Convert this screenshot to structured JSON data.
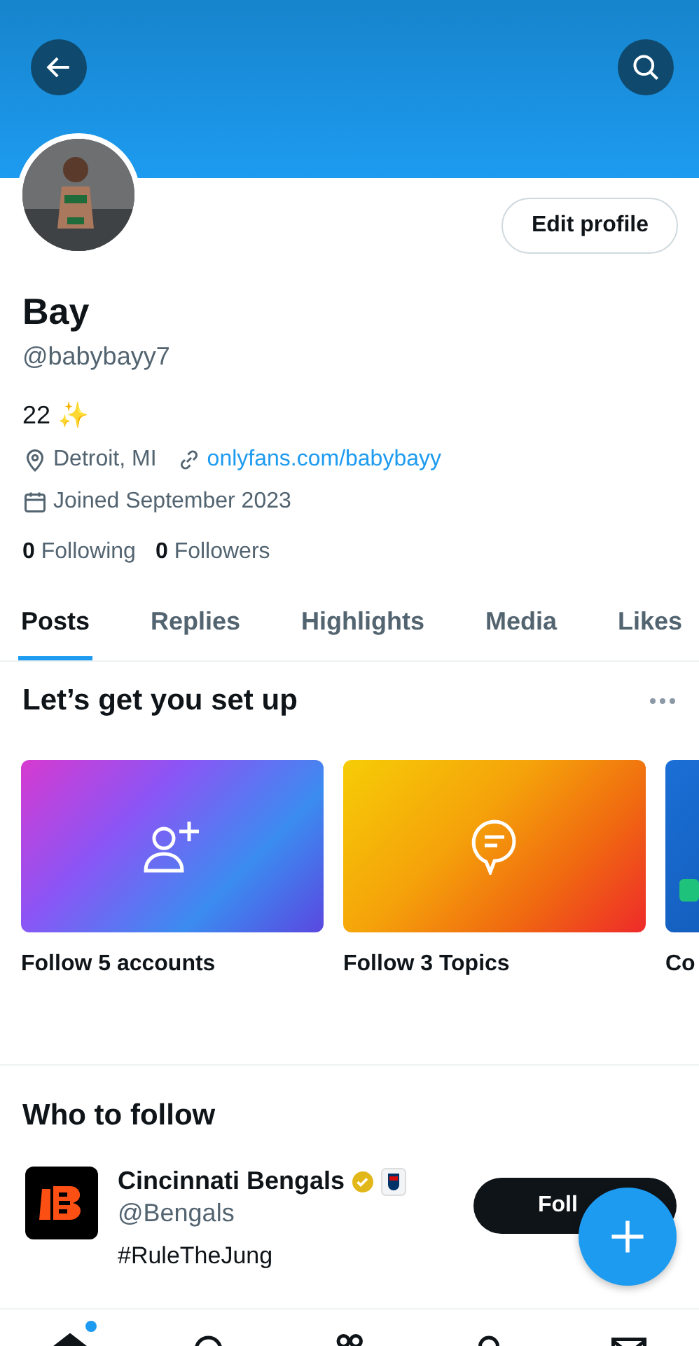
{
  "profile": {
    "edit_button": "Edit profile",
    "name": "Bay",
    "handle": "@babybayy7",
    "bio": "22 ✨",
    "location": "Detroit, MI",
    "link": "onlyfans.com/babybayy",
    "joined": "Joined September 2023",
    "following_count": "0",
    "following_label": "Following",
    "followers_count": "0",
    "followers_label": "Followers"
  },
  "tabs": [
    {
      "label": "Posts",
      "selected": true
    },
    {
      "label": "Replies",
      "selected": false
    },
    {
      "label": "Highlights",
      "selected": false
    },
    {
      "label": "Media",
      "selected": false
    },
    {
      "label": "Likes",
      "selected": false
    }
  ],
  "setup": {
    "title": "Let’s get you set up",
    "cards": [
      {
        "kind": "accounts",
        "label": "Follow 5 accounts"
      },
      {
        "kind": "topics",
        "label": "Follow 3 Topics"
      },
      {
        "kind": "other",
        "label": "Co"
      }
    ]
  },
  "who_to_follow": {
    "title": "Who to follow",
    "accounts": [
      {
        "name": "Cincinnati Bengals",
        "verified": true,
        "handle": "@Bengals",
        "bio": "#RuleTheJung",
        "button": "Foll"
      }
    ]
  },
  "bottom_nav": [
    {
      "kind": "home",
      "selected": true,
      "dot": true
    },
    {
      "kind": "search",
      "selected": false,
      "dot": false
    },
    {
      "kind": "communities",
      "selected": false,
      "dot": false
    },
    {
      "kind": "notifications",
      "selected": false,
      "dot": false
    },
    {
      "kind": "messages",
      "selected": false,
      "dot": false
    }
  ]
}
